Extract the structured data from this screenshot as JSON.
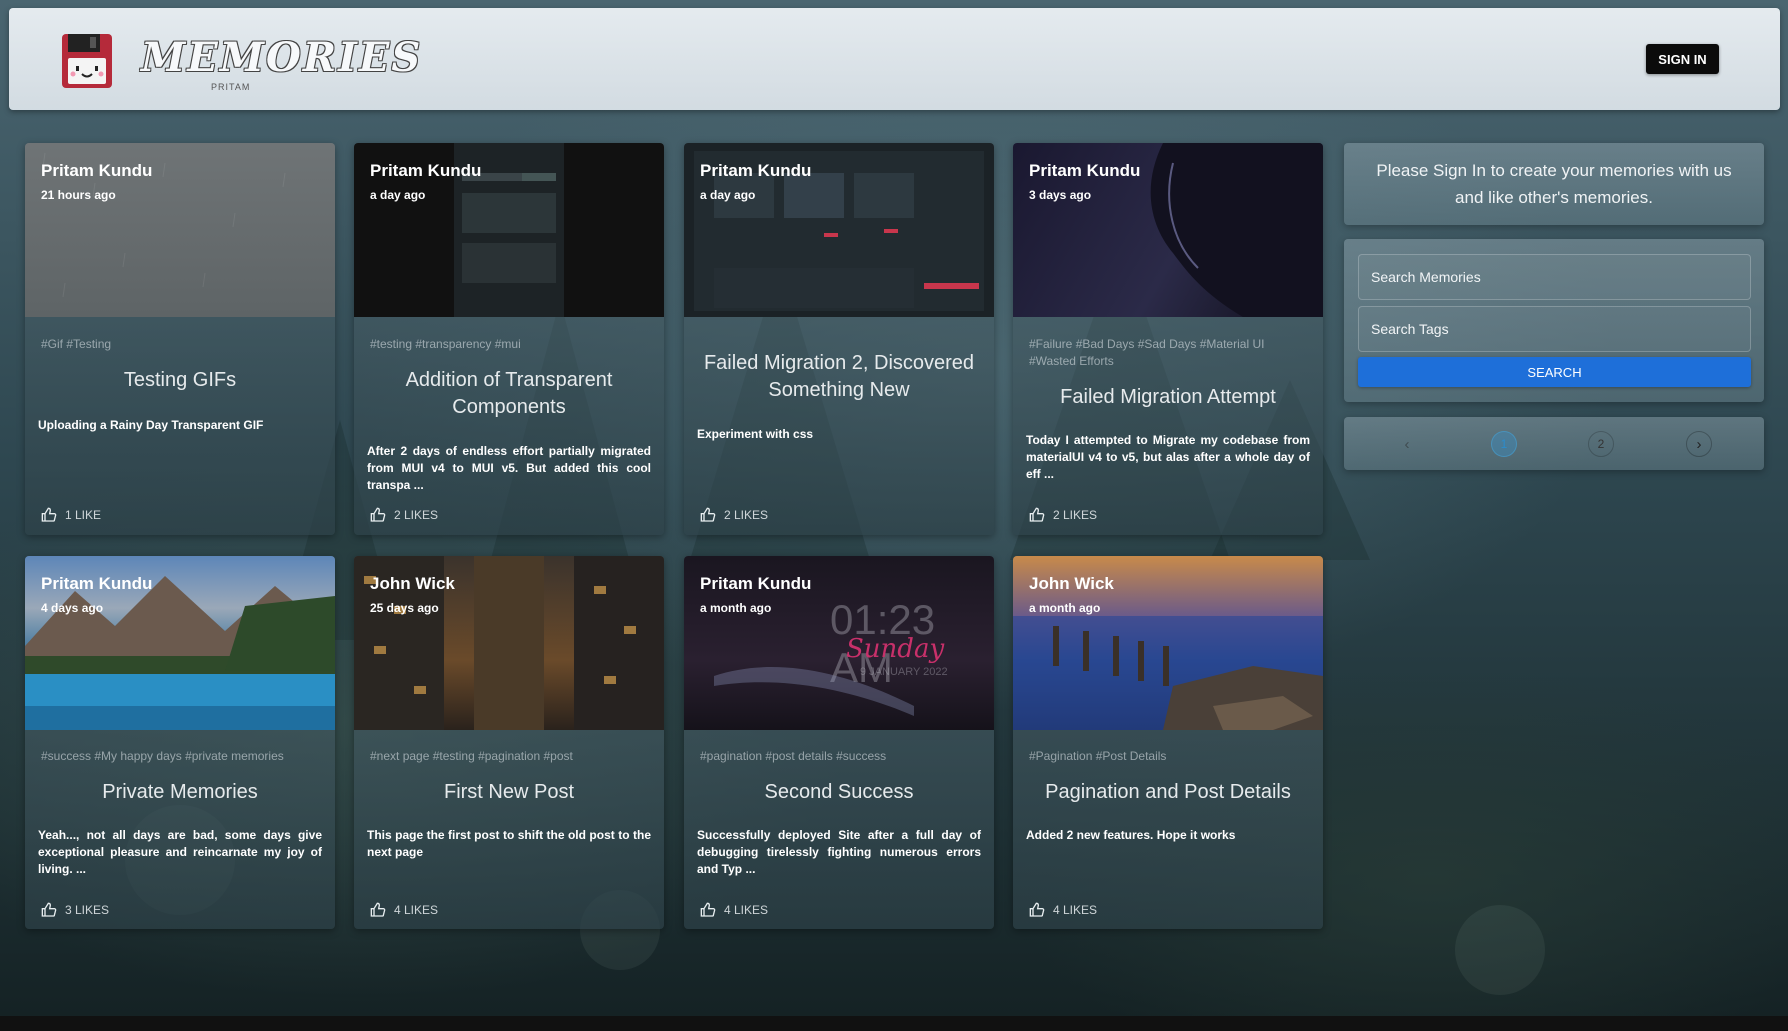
{
  "header": {
    "brand_title": "MEMORIES",
    "brand_subtitle": "PRITAM",
    "signin_label": "SIGN IN"
  },
  "posts": [
    {
      "author": "Pritam Kundu",
      "time": "21 hours ago",
      "tags": "#Gif #Testing",
      "title": "Testing GIFs",
      "message": "Uploading a Rainy Day Transparent GIF",
      "likes": "1 LIKE"
    },
    {
      "author": "Pritam Kundu",
      "time": "a day ago",
      "tags": "#testing #transparency #mui",
      "title": "Addition of Transparent Components",
      "message": "After 2 days of endless effort partially migrated from MUI v4 to MUI v5. But added this cool transpa ...",
      "likes": "2 LIKES"
    },
    {
      "author": "Pritam Kundu",
      "time": "a day ago",
      "tags": "",
      "title": "Failed Migration 2, Discovered Something New",
      "message": "Experiment with css",
      "likes": "2 LIKES"
    },
    {
      "author": "Pritam Kundu",
      "time": "3 days ago",
      "tags": "#Failure #Bad Days #Sad Days #Material UI #Wasted Efforts",
      "title": "Failed Migration Attempt",
      "message": "Today I attempted to Migrate my codebase from materialUI v4 to v5, but alas after a whole day of eff ...",
      "likes": "2 LIKES"
    },
    {
      "author": "Pritam Kundu",
      "time": "4 days ago",
      "tags": "#success #My happy days #private memories",
      "title": "Private Memories",
      "message": "Yeah..., not all days are bad, some days give exceptional pleasure and reincarnate my joy of living. ...",
      "likes": "3 LIKES"
    },
    {
      "author": "John Wick",
      "time": "25 days ago",
      "tags": "#next page #testing #pagination #post",
      "title": "First New Post",
      "message": "This page the first post to shift the old post to the next page",
      "likes": "4 LIKES"
    },
    {
      "author": "Pritam Kundu",
      "time": "a month ago",
      "tags": "#pagination #post details #success",
      "title": "Second Success",
      "message": "Successfully deployed Site after a full day of debugging tirelessly fighting numerous errors and Typ ...",
      "likes": "4 LIKES"
    },
    {
      "author": "John Wick",
      "time": "a month ago",
      "tags": "#Pagination #Post Details",
      "title": "Pagination and Post Details",
      "message": "Added 2 new features. Hope it works",
      "likes": "4 LIKES"
    }
  ],
  "image_text": {
    "clock": "01:23 AM",
    "day": "Sunday",
    "date": "9 JANUARY 2022"
  },
  "sidebar": {
    "notice": "Please Sign In to create your memories with us and like other's memories.",
    "search_placeholder": "Search Memories",
    "tags_placeholder": "Search Tags",
    "search_label": "SEARCH"
  },
  "pagination": {
    "prev": "‹",
    "pages": [
      "1",
      "2"
    ],
    "next": "›"
  },
  "colors": {
    "primary": "#1e6fd9",
    "signin": "#0b0b0b"
  }
}
